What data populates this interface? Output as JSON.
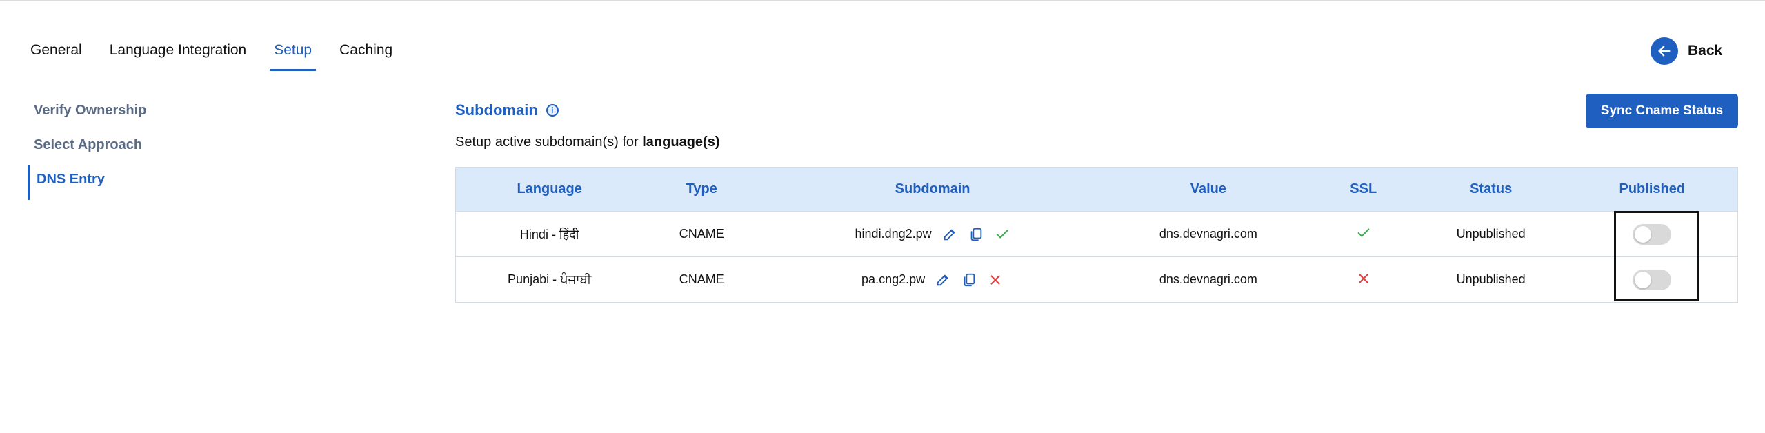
{
  "tabs": [
    {
      "label": "General",
      "active": false
    },
    {
      "label": "Language Integration",
      "active": false
    },
    {
      "label": "Setup",
      "active": true
    },
    {
      "label": "Caching",
      "active": false
    }
  ],
  "back_label": "Back",
  "leftnav": [
    {
      "label": "Verify Ownership",
      "active": false
    },
    {
      "label": "Select Approach",
      "active": false
    },
    {
      "label": "DNS Entry",
      "active": true
    }
  ],
  "section": {
    "title": "Subdomain",
    "info_glyph": "i",
    "desc_prefix": "Setup active subdomain(s) for ",
    "desc_bold": "language(s)"
  },
  "sync_button": "Sync Cname Status",
  "table": {
    "headers": [
      "Language",
      "Type",
      "Subdomain",
      "Value",
      "SSL",
      "Status",
      "Published"
    ],
    "rows": [
      {
        "language": "Hindi - हिंदी",
        "type": "CNAME",
        "subdomain": "hindi.dng2.pw",
        "verified": true,
        "value": "dns.devnagri.com",
        "ssl": true,
        "status": "Unpublished",
        "published": false
      },
      {
        "language": "Punjabi - ਪੰਜਾਬੀ",
        "type": "CNAME",
        "subdomain": "pa.cng2.pw",
        "verified": false,
        "value": "dns.devnagri.com",
        "ssl": false,
        "status": "Unpublished",
        "published": false
      }
    ]
  },
  "colors": {
    "accent": "#1f5fbf",
    "header_bg": "#dbeafb",
    "success": "#2fb34a",
    "error": "#e23b3b"
  }
}
